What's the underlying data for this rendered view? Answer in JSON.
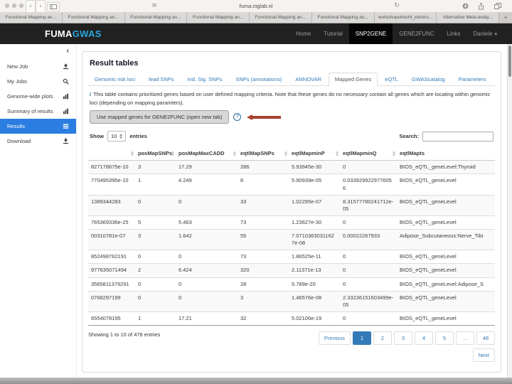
{
  "browser": {
    "url": "fuma.ctglab.nl",
    "back_glyph": "‹",
    "forward_glyph": "›",
    "reload_glyph": "↻",
    "tab_overview_glyph": "≡",
    "new_tab_label": "+",
    "tabs": [
      "Functional Mapping an...",
      "Functional Mapping an...",
      "Functional Mapping an...",
      "Functional Mapping an...",
      "Functional Mapping an...",
      "Functional Mapping an...",
      "workshoputrecht_electro...",
      "Alternative Meta-analy..."
    ]
  },
  "navbar": {
    "brand_fuma": "FUMA",
    "brand_gwas": "GWAS",
    "caret_glyph": "▾",
    "items": [
      {
        "label": "Home",
        "active": false
      },
      {
        "label": "Tutorial",
        "active": false
      },
      {
        "label": "SNP2GENE",
        "active": true
      },
      {
        "label": "GENE2FUNC",
        "active": false
      },
      {
        "label": "Links",
        "active": false
      },
      {
        "label": "Daniele",
        "active": false,
        "caret": true
      }
    ]
  },
  "sidebar": {
    "collapse_glyph": "‹",
    "items": [
      {
        "label": "New Job",
        "icon": "upload-icon",
        "active": false
      },
      {
        "label": "My Jobs",
        "icon": "search-icon",
        "active": false
      },
      {
        "label": "Genome-wide plots",
        "icon": "chart-icon",
        "active": false
      },
      {
        "label": "Summary of results",
        "icon": "chart-icon",
        "active": false
      },
      {
        "label": "Results",
        "icon": "list-icon",
        "active": true
      },
      {
        "label": "Download",
        "icon": "download-icon",
        "active": false
      }
    ]
  },
  "main": {
    "title": "Result tables",
    "tabs": [
      {
        "label": "Genomic risk loci",
        "active": false
      },
      {
        "label": "lead SNPs",
        "active": false
      },
      {
        "label": "Ind. Sig. SNPs",
        "active": false
      },
      {
        "label": "SNPs (annotations)",
        "active": false
      },
      {
        "label": "ANNOVAR",
        "active": false
      },
      {
        "label": "Mapped Genes",
        "active": true
      },
      {
        "label": "eQTL",
        "active": false
      },
      {
        "label": "GWAScatalog",
        "active": false
      },
      {
        "label": "Parameters",
        "active": false
      }
    ],
    "info_icon": "i",
    "info_text": "This table contains prioritized genes based on user defined mapping criteria. Note that these genes do no necessary contain all genes which are locating within genomic loci (depending on mapping paramters).",
    "gene2func_button": "Use mapped genes for GENE2FUNC (open new tab)",
    "help_glyph": "?",
    "controls": {
      "show_label": "Show",
      "page_size": "10",
      "entries_label": "entries",
      "search_label": "Search:",
      "search_value": ""
    },
    "table": {
      "columns": [
        "",
        "posMapSNPs",
        "posMapMaxCADD",
        "eqtlMapSNPs",
        "eqtlMapminP",
        "eqtlMapminQ",
        "eqtlMapts"
      ],
      "rows": [
        [
          "827178675e-10",
          "3",
          "17.29",
          "286",
          "5.93945e-30",
          "0",
          "BIOS_eQTL_geneLevel:Thyroid"
        ],
        [
          "770495395e-10",
          "1",
          "4.249",
          "8",
          "5.90939e-05",
          "0.0339299229776056",
          "BIOS_eQTL_geneLevel"
        ],
        [
          "1389344283",
          "0",
          "0",
          "33",
          "1.02295e-07",
          "8.31577780241712e-05",
          "BIOS_eQTL_geneLevel"
        ],
        [
          "765369336e-25",
          "5",
          "5.463",
          "73",
          "1.23627e-30",
          "0",
          "BIOS_eQTL_geneLevel"
        ],
        [
          "00310781e-07",
          "3",
          "1.642",
          "55",
          "7.07103630311627e-08",
          "0.00022267933",
          "Adipose_Subcutaneous:Nerve_Tibi"
        ],
        [
          "852498762191",
          "0",
          "0",
          "73",
          "1.86525e-11",
          "0",
          "BIOS_eQTL_geneLevel"
        ],
        [
          "977635071494",
          "2",
          "6.424",
          "320",
          "2.11371e-13",
          "0",
          "BIOS_eQTL_geneLevel"
        ],
        [
          "3565811379291",
          "0",
          "0",
          "28",
          "5.789e-20",
          "0",
          "BIOS_eQTL_geneLevel:Adipose_S"
        ],
        [
          "0768297199",
          "0",
          "0",
          "3",
          "1.46576e-08",
          "2.33236151603499e-05",
          "BIOS_eQTL_geneLevel"
        ],
        [
          "6554078195",
          "1",
          "17.21",
          "32",
          "5.02106e-19",
          "0",
          "BIOS_eQTL_geneLevel"
        ]
      ]
    },
    "footer": {
      "showing_text": "Showing 1 to 10 of 478 entries",
      "prev_label": "Previous",
      "pages": [
        "1",
        "2",
        "3",
        "4",
        "5",
        "...",
        "48"
      ],
      "active_page": "1",
      "next_label": "Next"
    }
  },
  "colors": {
    "navbar_bg": "#212121",
    "brand_blue": "#2da4dd",
    "sidebar_active_blue": "#2b7de1",
    "link_blue": "#337ab7",
    "annotation_arrow_red": "#a8402f",
    "row_stripe": "#f9f9f9"
  }
}
